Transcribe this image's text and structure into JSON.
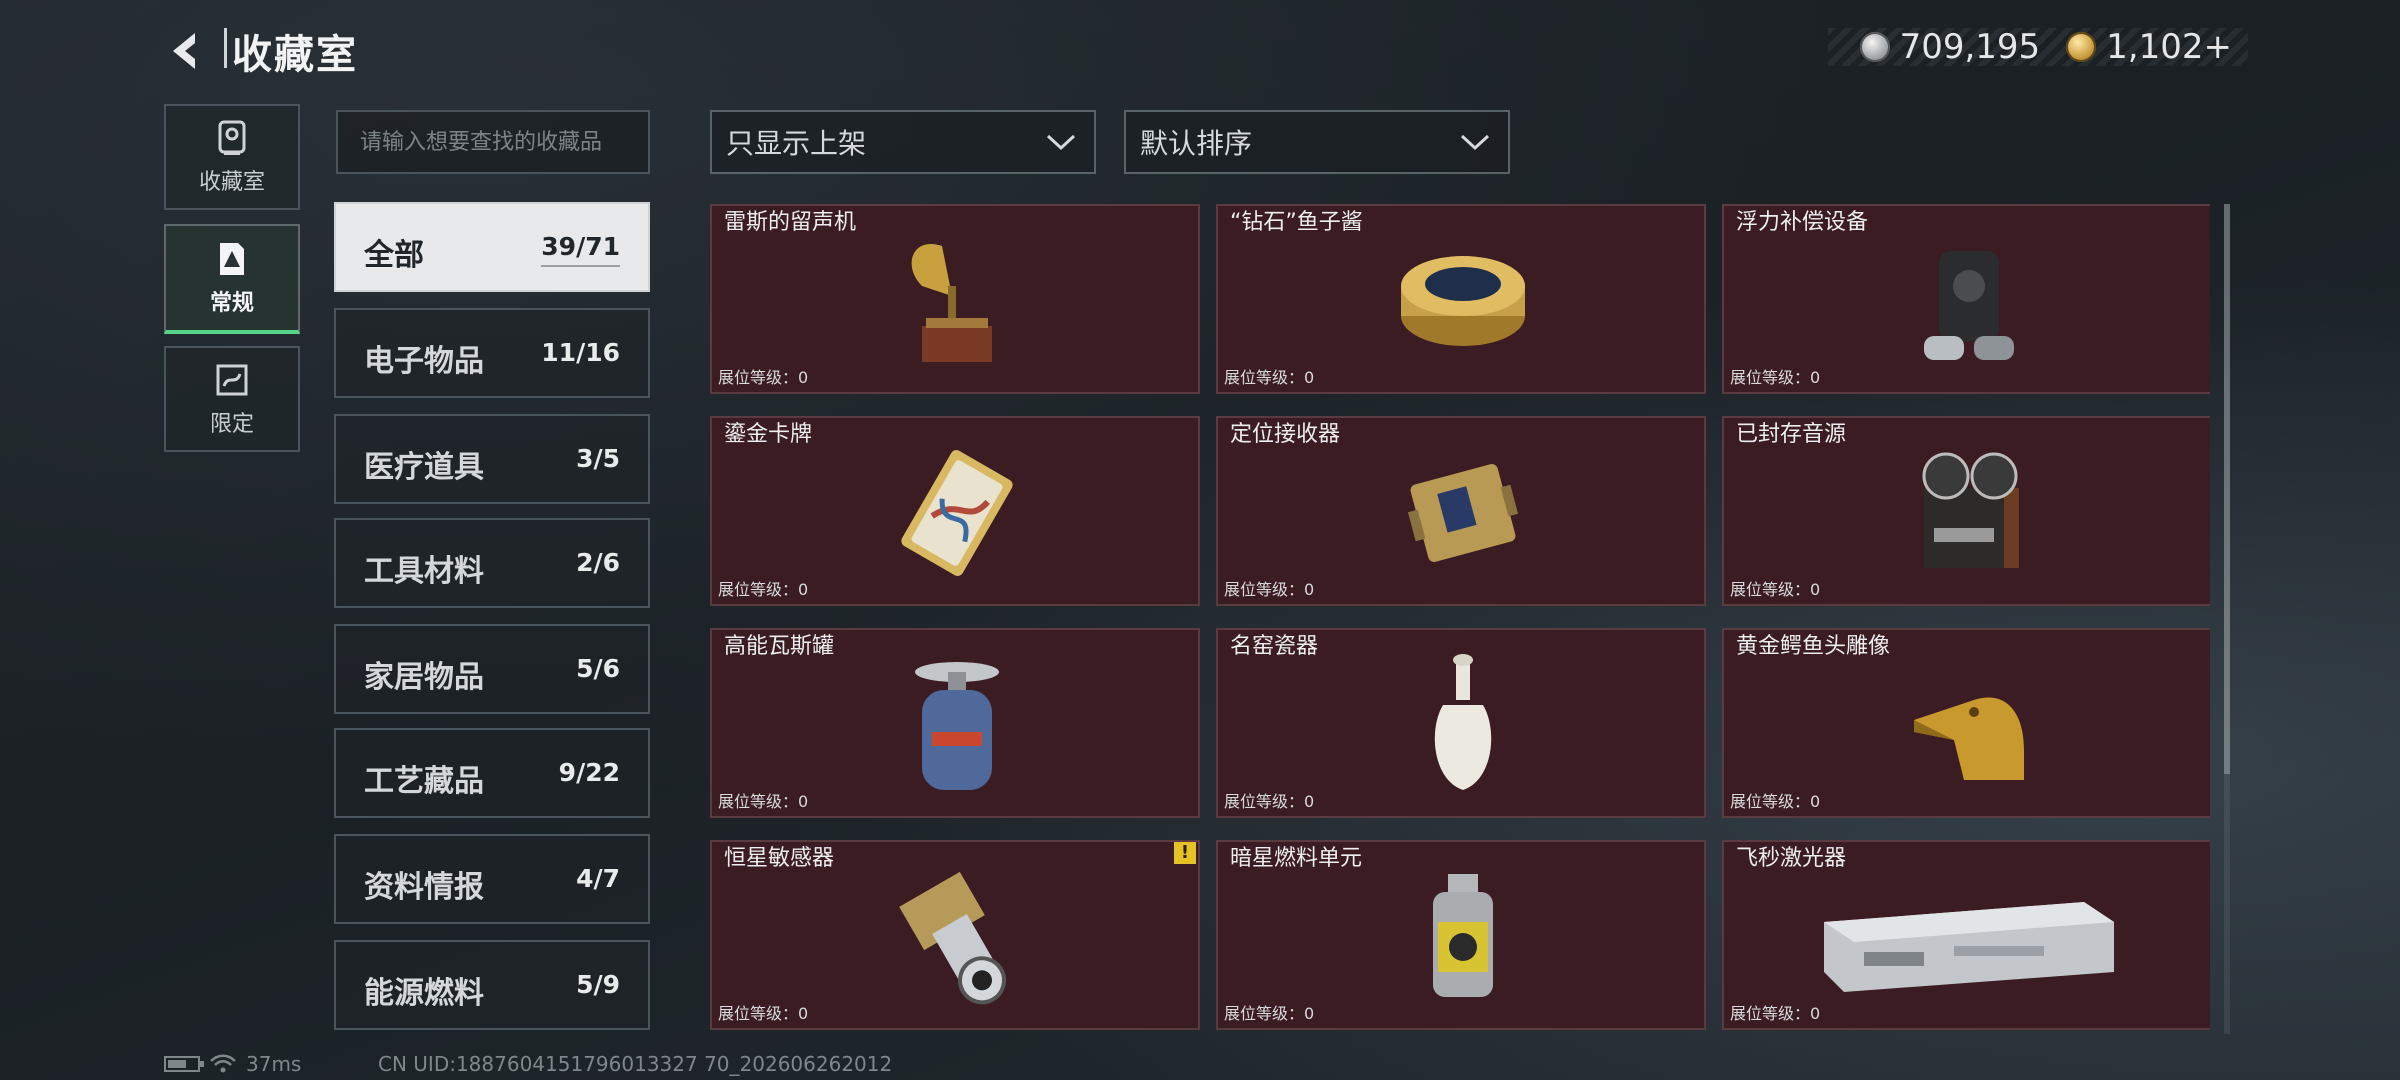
{
  "header": {
    "title": "收藏室",
    "currency": [
      {
        "icon": "silver-coin-icon",
        "value": "709,195"
      },
      {
        "icon": "gold-coin-icon",
        "value": "1,102+"
      }
    ]
  },
  "tabs": [
    {
      "label": "收藏室",
      "icon": "collection-room-icon",
      "active": false
    },
    {
      "label": "常规",
      "icon": "regular-icon",
      "active": true
    },
    {
      "label": "限定",
      "icon": "limited-icon",
      "active": false
    }
  ],
  "search": {
    "placeholder": "请输入想要查找的收藏品"
  },
  "filters": {
    "shelf_filter": "只显示上架",
    "sort": "默认排序"
  },
  "categories": [
    {
      "name": "全部",
      "count": "39/71"
    },
    {
      "name": "电子物品",
      "count": "11/16"
    },
    {
      "name": "医疗道具",
      "count": "3/5"
    },
    {
      "name": "工具材料",
      "count": "2/6"
    },
    {
      "name": "家居物品",
      "count": "5/6"
    },
    {
      "name": "工艺藏品",
      "count": "9/22"
    },
    {
      "name": "资料情报",
      "count": "4/7"
    },
    {
      "name": "能源燃料",
      "count": "5/9"
    }
  ],
  "items": [
    {
      "name": "雷斯的留声机",
      "level": "展位等级：0",
      "icon": "gramophone-icon"
    },
    {
      "name": "“钻石”鱼子酱",
      "level": "展位等级：0",
      "icon": "caviar-tin-icon"
    },
    {
      "name": "浮力补偿设备",
      "level": "展位等级：0",
      "icon": "buoyancy-device-icon"
    },
    {
      "name": "鎏金卡牌",
      "level": "展位等级：0",
      "icon": "gilded-card-icon"
    },
    {
      "name": "定位接收器",
      "level": "展位等级：0",
      "icon": "locator-receiver-icon"
    },
    {
      "name": "已封存音源",
      "level": "展位等级：0",
      "icon": "reel-recorder-icon"
    },
    {
      "name": "高能瓦斯罐",
      "level": "展位等级：0",
      "icon": "gas-canister-icon"
    },
    {
      "name": "名窑瓷器",
      "level": "展位等级：0",
      "icon": "porcelain-vase-icon"
    },
    {
      "name": "黄金鳄鱼头雕像",
      "level": "展位等级：0",
      "icon": "gold-crocodile-head-icon"
    },
    {
      "name": "恒星敏感器",
      "level": "展位等级：0",
      "icon": "star-sensor-icon",
      "warning": "!"
    },
    {
      "name": "暗星燃料单元",
      "level": "展位等级：0",
      "icon": "fuel-cell-icon"
    },
    {
      "name": "飞秒激光器",
      "level": "展位等级：0",
      "icon": "femtosecond-laser-icon"
    }
  ],
  "footer": {
    "latency": "37ms",
    "uid": "CN UID:1887604151796013327 70_202606262012"
  },
  "colors": {
    "accent_green": "#56d48a",
    "card_bg": "#3b1c22",
    "warning": "#e6c227"
  }
}
